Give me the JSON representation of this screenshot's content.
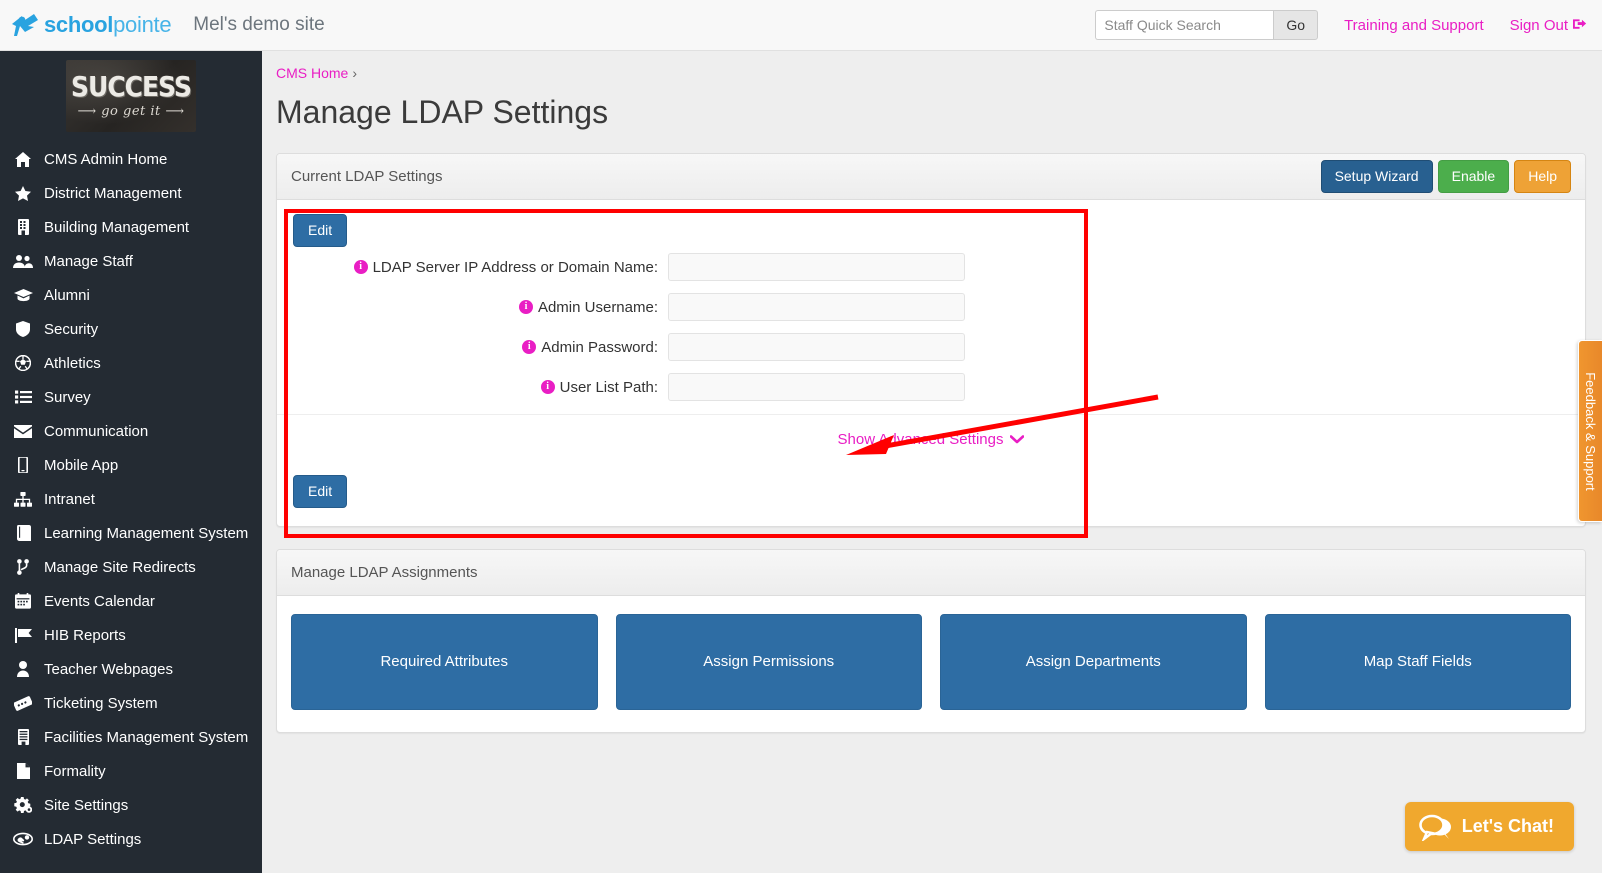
{
  "header": {
    "brand_bold": "school",
    "brand_light": "pointe",
    "site_name": "Mel's demo site",
    "search": {
      "placeholder": "Staff Quick Search",
      "value": "",
      "go_label": "Go"
    },
    "training_link": "Training and Support",
    "signout_link": "Sign Out",
    "signout_icon": "sign-out-icon"
  },
  "sidebar": {
    "logo": {
      "word": "SUCCESS",
      "tagline": "go get it"
    },
    "items": [
      {
        "label": "CMS Admin Home",
        "icon": "home-icon"
      },
      {
        "label": "District Management",
        "icon": "star-icon"
      },
      {
        "label": "Building Management",
        "icon": "building-icon"
      },
      {
        "label": "Manage Staff",
        "icon": "users-icon"
      },
      {
        "label": "Alumni",
        "icon": "graduation-cap-icon"
      },
      {
        "label": "Security",
        "icon": "shield-icon"
      },
      {
        "label": "Athletics",
        "icon": "soccer-ball-icon"
      },
      {
        "label": "Survey",
        "icon": "list-icon"
      },
      {
        "label": "Communication",
        "icon": "envelope-icon"
      },
      {
        "label": "Mobile App",
        "icon": "mobile-phone-icon"
      },
      {
        "label": "Intranet",
        "icon": "sitemap-icon"
      },
      {
        "label": "Learning Management System",
        "icon": "book-icon"
      },
      {
        "label": "Manage Site Redirects",
        "icon": "code-fork-icon"
      },
      {
        "label": "Events Calendar",
        "icon": "calendar-icon"
      },
      {
        "label": "HIB Reports",
        "icon": "flag-icon"
      },
      {
        "label": "Teacher Webpages",
        "icon": "user-icon"
      },
      {
        "label": "Ticketing System",
        "icon": "ticket-icon"
      },
      {
        "label": "Facilities Management System",
        "icon": "building-list-icon"
      },
      {
        "label": "Formality",
        "icon": "file-icon"
      },
      {
        "label": "Site Settings",
        "icon": "gears-icon"
      },
      {
        "label": "LDAP Settings",
        "icon": "handshake-icon"
      }
    ]
  },
  "main": {
    "breadcrumb": {
      "home_label": "CMS Home",
      "separator": "›"
    },
    "page_title": "Manage LDAP Settings",
    "settings_panel": {
      "title": "Current LDAP Settings",
      "buttons": {
        "setup_wizard": "Setup Wizard",
        "enable": "Enable",
        "help": "Help"
      },
      "edit_top_label": "Edit",
      "edit_bottom_label": "Edit",
      "fields": [
        {
          "label": "LDAP Server IP Address or Domain Name:",
          "value": "",
          "info_icon": "info-circle-icon"
        },
        {
          "label": "Admin Username:",
          "value": "",
          "info_icon": "info-circle-icon"
        },
        {
          "label": "Admin Password:",
          "value": "",
          "info_icon": "info-circle-icon"
        },
        {
          "label": "User List Path:",
          "value": "",
          "info_icon": "info-circle-icon"
        }
      ],
      "advanced_link": "Show Advanced Settings",
      "advanced_chevron": "chevron-down-icon"
    },
    "assignments_panel": {
      "title": "Manage LDAP Assignments",
      "buttons": [
        "Required Attributes",
        "Assign Permissions",
        "Assign Departments",
        "Map Staff Fields"
      ]
    }
  },
  "feedback_tab": {
    "label": "Feedback & Support"
  },
  "chat_widget": {
    "label": "Let's Chat!",
    "icon": "speech-bubbles-icon"
  },
  "annotation": {
    "shape": "red-rectangle-and-arrow",
    "color": "#ff0000"
  },
  "colors": {
    "brand_blue": "#29a3e0",
    "accent_magenta": "#e91ec4",
    "sidebar_bg": "#242b33",
    "primary_button": "#286090",
    "success_button": "#4cae4c",
    "warning_button": "#eea236",
    "annotation_red": "#ff0000",
    "chat_orange": "#f0a82e"
  }
}
